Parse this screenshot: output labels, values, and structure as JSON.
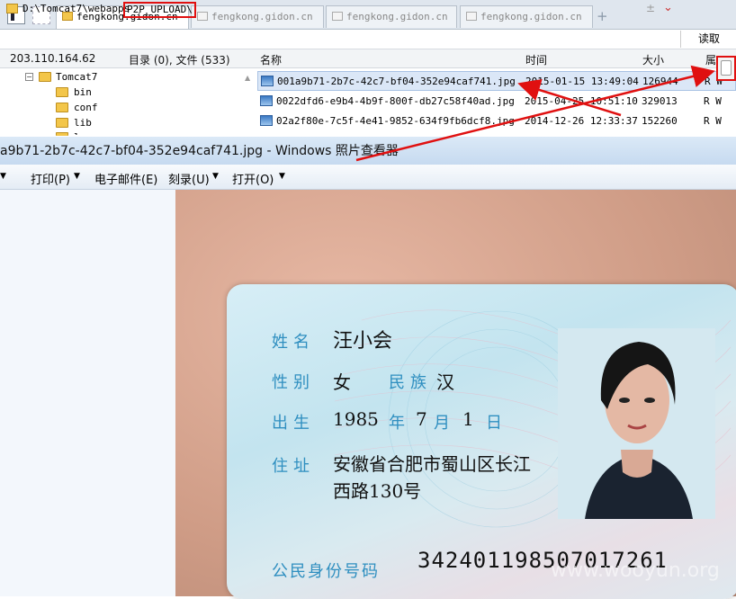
{
  "file_manager": {
    "tabs": [
      {
        "label": "fengkong.gidon.cn",
        "active": true
      },
      {
        "label": "fengkong.gidon.cn",
        "active": false
      },
      {
        "label": "fengkong.gidon.cn",
        "active": false
      },
      {
        "label": "fengkong.gidon.cn",
        "active": false
      }
    ],
    "address_prefix": "D:\\Tomcat7\\webapps",
    "address_highlight": "P2P_UPLOAD\\",
    "address_right_symbol": "±",
    "read_button": "读取",
    "ip": "203.110.164.62",
    "summary": "目录 (0), 文件 (533)",
    "columns": {
      "name": "名称",
      "time": "时间",
      "size": "大小",
      "attr": "属"
    },
    "tree": [
      {
        "label": "Tomcat7"
      },
      {
        "label": "bin"
      },
      {
        "label": "conf"
      },
      {
        "label": "lib"
      },
      {
        "label": "l"
      }
    ],
    "files": [
      {
        "name": "001a9b71-2b7c-42c7-bf04-352e94caf741.jpg",
        "time": "2015-01-15 13:49:04",
        "size": "126944",
        "attr": "R W"
      },
      {
        "name": "0022dfd6-e9b4-4b9f-800f-db27c58f40ad.jpg",
        "time": "2015-04-25 10:51:10",
        "size": "329013",
        "attr": "R W"
      },
      {
        "name": "02a2f80e-7c5f-4e41-9852-634f9fb6dcf8.jpg",
        "time": "2014-12-26 12:33:37",
        "size": "152260",
        "attr": "R W"
      }
    ]
  },
  "photo_viewer": {
    "title": "a9b71-2b7c-42c7-bf04-352e94caf741.jpg - Windows 照片查看器",
    "menu": [
      {
        "label": "打印(P)"
      },
      {
        "label": "电子邮件(E)"
      },
      {
        "label": "刻录(U)"
      },
      {
        "label": "打开(O)"
      }
    ],
    "card": {
      "name_label": "姓名",
      "name_value": "汪小会",
      "sex_label": "性别",
      "sex_value": "女",
      "ethnic_label": "民族",
      "ethnic_value": "汉",
      "birth_label": "出生",
      "birth_year": "1985",
      "year_char": "年",
      "birth_month": "7",
      "month_char": "月",
      "birth_day": "1",
      "day_char": "日",
      "address_label": "住址",
      "address_line1": "安徽省合肥市蜀山区长江",
      "address_line2": "西路130号",
      "id_label": "公民身份号码",
      "id_value": "342401198507017261"
    },
    "watermark": "www.wooyun.org"
  },
  "colors": {
    "highlight_red": "#e01010",
    "card_label_blue": "#2f8fc0",
    "selection": "#dbe7f7"
  }
}
